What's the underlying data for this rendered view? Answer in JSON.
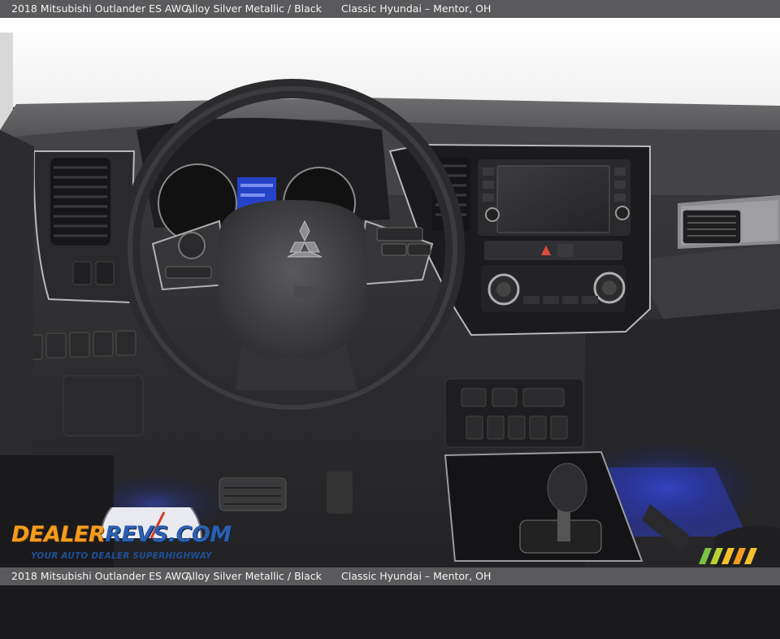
{
  "top_bar": {
    "vehicle": "2018 Mitsubishi Outlander ES AWC,",
    "color": "Alloy Silver Metallic / Black",
    "dealer": "Classic Hyundai – Mentor, OH"
  },
  "bottom_bar": {
    "vehicle": "2018 Mitsubishi Outlander ES AWC,",
    "color": "Alloy Silver Metallic / Black",
    "dealer": "Classic Hyundai – Mentor, OH"
  },
  "logo": {
    "name_part1": "DEALER",
    "name_part2": "REVS",
    "name_part3": ".COM",
    "tagline": "YOUR AUTO DEALER SUPERHIGHWAY"
  },
  "colors": {
    "bar_bg": "#5a5a5c",
    "logo_orange": "#f39c1f",
    "logo_blue": "#2b5fb0",
    "ambient_blue": "#3b4fd8"
  }
}
